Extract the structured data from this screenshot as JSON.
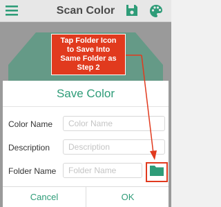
{
  "app_bar": {
    "title": "Scan Color",
    "menu_icon": "hamburger-menu-icon",
    "save_icon": "floppy-disk-icon",
    "palette_icon": "palette-icon"
  },
  "swatch": {
    "color": "#3a9a78"
  },
  "dialog": {
    "title": "Save Color",
    "fields": [
      {
        "label": "Color Name",
        "placeholder": "Color Name",
        "value": ""
      },
      {
        "label": "Description",
        "placeholder": "Description",
        "value": ""
      },
      {
        "label": "Folder Name",
        "placeholder": "Folder Name",
        "value": ""
      }
    ],
    "folder_icon": "folder-icon",
    "cancel_label": "Cancel",
    "ok_label": "OK"
  },
  "annotation": {
    "callout_lines": [
      "Tap Folder Icon",
      "to Save Into",
      "Same Folder as",
      "Step 2"
    ]
  },
  "colors": {
    "accent": "#2e9c78",
    "annotation": "#e13a1e"
  }
}
